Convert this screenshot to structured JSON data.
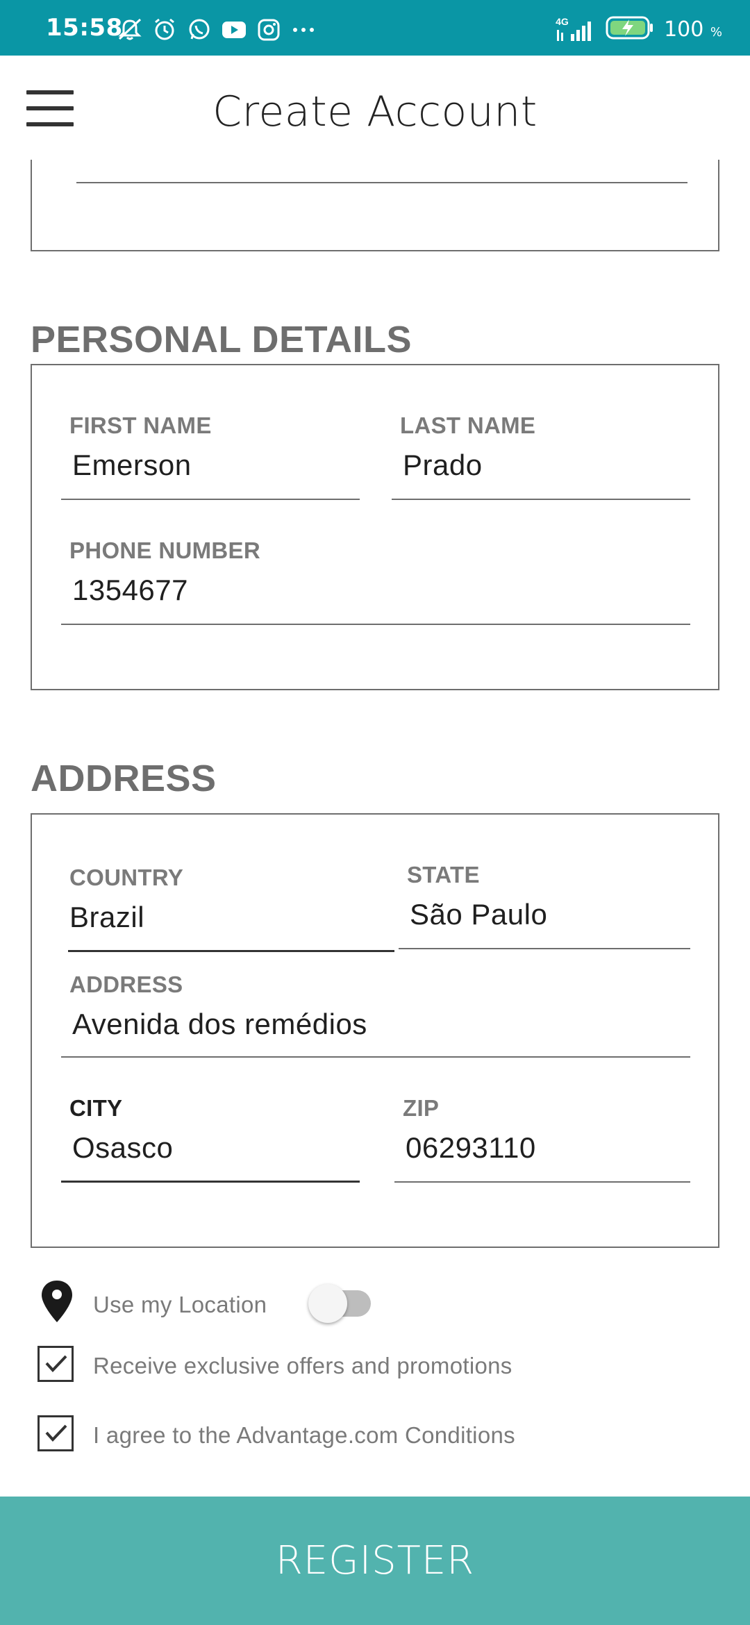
{
  "status_bar": {
    "time": "15:58",
    "network": "4G",
    "battery": "100",
    "battery_unit": "%",
    "icons": [
      "mute-icon",
      "alarm-icon",
      "whatsapp-icon",
      "youtube-icon",
      "instagram-icon",
      "more-dots-icon"
    ]
  },
  "app_bar": {
    "title": "Create Account"
  },
  "personal_details": {
    "title": "PERSONAL DETAILS",
    "first_name_label": "FIRST NAME",
    "first_name_value": "Emerson",
    "last_name_label": "LAST NAME",
    "last_name_value": "Prado",
    "phone_label": "PHONE NUMBER",
    "phone_value": "1354677"
  },
  "address": {
    "title": "ADDRESS",
    "country_label": "COUNTRY",
    "country_value": "Brazil",
    "state_label": "STATE",
    "state_value": "São Paulo",
    "address_label": "ADDRESS",
    "address_value": "Avenida dos remédios",
    "city_label": "CITY",
    "city_value": "Osasco",
    "zip_label": "ZIP",
    "zip_value": "06293110"
  },
  "options": {
    "use_location_label": "Use my Location",
    "use_location_on": false,
    "offers_label": "Receive exclusive offers and promotions",
    "offers_checked": true,
    "conditions_label": "I agree to the Advantage.com Conditions",
    "conditions_checked": true
  },
  "register_label": "REGISTER",
  "colors": {
    "status_bar": "#0a96a5",
    "register_button": "#52b3ae",
    "section_text": "#6e6e6e"
  }
}
